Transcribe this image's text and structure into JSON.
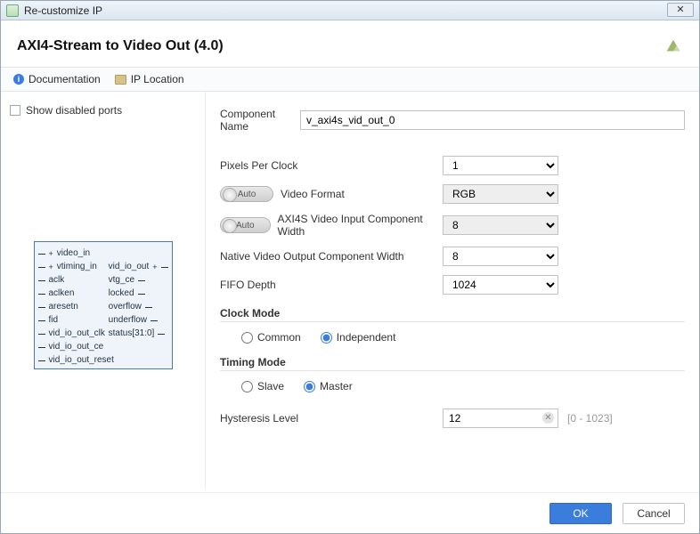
{
  "titlebar": {
    "title": "Re-customize IP"
  },
  "header": {
    "ip_title": "AXI4-Stream to Video Out (4.0)"
  },
  "toolbar": {
    "documentation": "Documentation",
    "ip_location": "IP Location"
  },
  "left": {
    "show_disabled_ports": "Show disabled ports",
    "ports_in": [
      "video_in",
      "vtiming_in",
      "aclk",
      "aclken",
      "aresetn",
      "fid",
      "vid_io_out_clk",
      "vid_io_out_ce",
      "vid_io_out_reset"
    ],
    "ports_out": [
      "vid_io_out",
      "vtg_ce",
      "locked",
      "overflow",
      "underflow",
      "status[31:0]"
    ]
  },
  "form": {
    "component_name_label": "Component Name",
    "component_name_value": "v_axi4s_vid_out_0",
    "pixels_per_clock_label": "Pixels Per Clock",
    "pixels_per_clock_value": "1",
    "auto": "Auto",
    "video_format_label": "Video Format",
    "video_format_value": "RGB",
    "axi4s_input_width_label": "AXI4S Video Input Component Width",
    "axi4s_input_width_value": "8",
    "native_output_width_label": "Native Video Output Component Width",
    "native_output_width_value": "8",
    "fifo_depth_label": "FIFO Depth",
    "fifo_depth_value": "1024",
    "clock_mode_title": "Clock Mode",
    "clock_mode_common": "Common",
    "clock_mode_independent": "Independent",
    "timing_mode_title": "Timing Mode",
    "timing_mode_slave": "Slave",
    "timing_mode_master": "Master",
    "hysteresis_label": "Hysteresis Level",
    "hysteresis_value": "12",
    "hysteresis_hint": "[0 - 1023]"
  },
  "footer": {
    "ok": "OK",
    "cancel": "Cancel"
  }
}
